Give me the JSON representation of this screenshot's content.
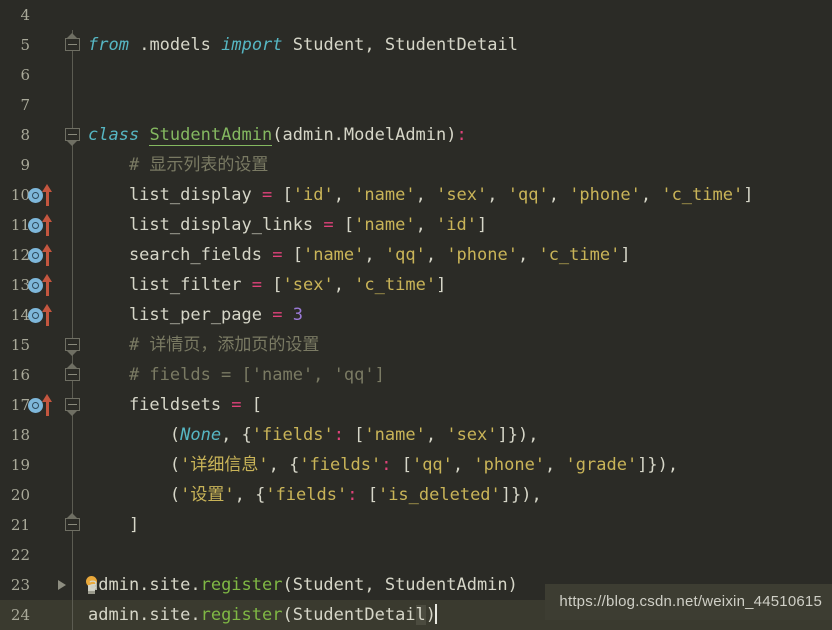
{
  "editor": {
    "theme_bg": "#2b2b26",
    "current_line_bg": "#3a3a2f",
    "gutter_number_color": "#a9a999",
    "accent_keyword": "#56b6c2",
    "accent_string": "#c9b458",
    "accent_operator": "#e0427a",
    "accent_function": "#7fb844",
    "accent_class": "#84b860",
    "accent_comment": "#7a7a63",
    "accent_number": "#9a79d6"
  },
  "lines": [
    {
      "number": "4",
      "markers": {
        "override": false,
        "uparrow": false,
        "fold": "none",
        "fold_line": false,
        "bulb": false,
        "run_triangle": false
      },
      "tokens": []
    },
    {
      "number": "5",
      "markers": {
        "override": false,
        "uparrow": false,
        "fold": "cap-up-box",
        "fold_line": true,
        "bulb": false,
        "run_triangle": false
      },
      "tokens": [
        {
          "t": "from",
          "c": "kw"
        },
        {
          "t": " ",
          "c": "def"
        },
        {
          "t": ".models",
          "c": "def"
        },
        {
          "t": " ",
          "c": "def"
        },
        {
          "t": "import",
          "c": "kw"
        },
        {
          "t": " Student, StudentDetail",
          "c": "def"
        }
      ]
    },
    {
      "number": "6",
      "markers": {
        "override": false,
        "uparrow": false,
        "fold": "none",
        "fold_line": true,
        "bulb": false,
        "run_triangle": false
      },
      "tokens": []
    },
    {
      "number": "7",
      "markers": {
        "override": false,
        "uparrow": false,
        "fold": "none",
        "fold_line": true,
        "bulb": false,
        "run_triangle": false
      },
      "tokens": []
    },
    {
      "number": "8",
      "markers": {
        "override": false,
        "uparrow": false,
        "fold": "box-cap-down",
        "fold_line": true,
        "bulb": false,
        "run_triangle": false
      },
      "tokens": [
        {
          "t": "class",
          "c": "kw"
        },
        {
          "t": " ",
          "c": "def"
        },
        {
          "t": "StudentAdmin",
          "c": "cls"
        },
        {
          "t": "(admin.ModelAdmin)",
          "c": "def"
        },
        {
          "t": ":",
          "c": "op"
        }
      ]
    },
    {
      "number": "9",
      "markers": {
        "override": false,
        "uparrow": false,
        "fold": "none",
        "fold_line": true,
        "bulb": false,
        "run_triangle": false
      },
      "tokens": [
        {
          "t": "    # 显示列表的设置",
          "c": "com"
        }
      ]
    },
    {
      "number": "10",
      "markers": {
        "override": true,
        "uparrow": true,
        "fold": "none",
        "fold_line": true,
        "bulb": false,
        "run_triangle": false
      },
      "tokens": [
        {
          "t": "    list_display ",
          "c": "def"
        },
        {
          "t": "=",
          "c": "op"
        },
        {
          "t": " [",
          "c": "punct"
        },
        {
          "t": "'id'",
          "c": "str"
        },
        {
          "t": ", ",
          "c": "punct"
        },
        {
          "t": "'name'",
          "c": "str"
        },
        {
          "t": ", ",
          "c": "punct"
        },
        {
          "t": "'sex'",
          "c": "str"
        },
        {
          "t": ", ",
          "c": "punct"
        },
        {
          "t": "'qq'",
          "c": "str"
        },
        {
          "t": ", ",
          "c": "punct"
        },
        {
          "t": "'phone'",
          "c": "str"
        },
        {
          "t": ", ",
          "c": "punct"
        },
        {
          "t": "'c_time'",
          "c": "str"
        },
        {
          "t": "]",
          "c": "punct"
        }
      ]
    },
    {
      "number": "11",
      "markers": {
        "override": true,
        "uparrow": true,
        "fold": "none",
        "fold_line": true,
        "bulb": false,
        "run_triangle": false
      },
      "tokens": [
        {
          "t": "    list_display_links ",
          "c": "def"
        },
        {
          "t": "=",
          "c": "op"
        },
        {
          "t": " [",
          "c": "punct"
        },
        {
          "t": "'name'",
          "c": "str"
        },
        {
          "t": ", ",
          "c": "punct"
        },
        {
          "t": "'id'",
          "c": "str"
        },
        {
          "t": "]",
          "c": "punct"
        }
      ]
    },
    {
      "number": "12",
      "markers": {
        "override": true,
        "uparrow": true,
        "fold": "none",
        "fold_line": true,
        "bulb": false,
        "run_triangle": false
      },
      "tokens": [
        {
          "t": "    search_fields ",
          "c": "def"
        },
        {
          "t": "=",
          "c": "op"
        },
        {
          "t": " [",
          "c": "punct"
        },
        {
          "t": "'name'",
          "c": "str"
        },
        {
          "t": ", ",
          "c": "punct"
        },
        {
          "t": "'qq'",
          "c": "str"
        },
        {
          "t": ", ",
          "c": "punct"
        },
        {
          "t": "'phone'",
          "c": "str"
        },
        {
          "t": ", ",
          "c": "punct"
        },
        {
          "t": "'c_time'",
          "c": "str"
        },
        {
          "t": "]",
          "c": "punct"
        }
      ]
    },
    {
      "number": "13",
      "markers": {
        "override": true,
        "uparrow": true,
        "fold": "none",
        "fold_line": true,
        "bulb": false,
        "run_triangle": false
      },
      "tokens": [
        {
          "t": "    list_filter ",
          "c": "def"
        },
        {
          "t": "=",
          "c": "op"
        },
        {
          "t": " [",
          "c": "punct"
        },
        {
          "t": "'sex'",
          "c": "str"
        },
        {
          "t": ", ",
          "c": "punct"
        },
        {
          "t": "'c_time'",
          "c": "str"
        },
        {
          "t": "]",
          "c": "punct"
        }
      ]
    },
    {
      "number": "14",
      "markers": {
        "override": true,
        "uparrow": true,
        "fold": "none",
        "fold_line": true,
        "bulb": false,
        "run_triangle": false
      },
      "tokens": [
        {
          "t": "    list_per_page ",
          "c": "def"
        },
        {
          "t": "=",
          "c": "op"
        },
        {
          "t": " ",
          "c": "punct"
        },
        {
          "t": "3",
          "c": "num"
        }
      ]
    },
    {
      "number": "15",
      "markers": {
        "override": false,
        "uparrow": false,
        "fold": "box-cap-down",
        "fold_line": true,
        "bulb": false,
        "run_triangle": false
      },
      "tokens": [
        {
          "t": "    # 详情页，添加页的设置",
          "c": "com"
        }
      ]
    },
    {
      "number": "16",
      "markers": {
        "override": false,
        "uparrow": false,
        "fold": "cap-up-box",
        "fold_line": true,
        "bulb": false,
        "run_triangle": false
      },
      "tokens": [
        {
          "t": "    # fields = ['name', 'qq']",
          "c": "com"
        }
      ]
    },
    {
      "number": "17",
      "markers": {
        "override": true,
        "uparrow": true,
        "fold": "box-cap-down",
        "fold_line": true,
        "bulb": false,
        "run_triangle": false
      },
      "tokens": [
        {
          "t": "    fieldsets ",
          "c": "def"
        },
        {
          "t": "=",
          "c": "op"
        },
        {
          "t": " [",
          "c": "punct"
        }
      ]
    },
    {
      "number": "18",
      "markers": {
        "override": false,
        "uparrow": false,
        "fold": "none",
        "fold_line": true,
        "bulb": false,
        "run_triangle": false
      },
      "tokens": [
        {
          "t": "        (",
          "c": "punct"
        },
        {
          "t": "None",
          "c": "none"
        },
        {
          "t": ", {",
          "c": "punct"
        },
        {
          "t": "'fields'",
          "c": "str"
        },
        {
          "t": ":",
          "c": "op"
        },
        {
          "t": " [",
          "c": "punct"
        },
        {
          "t": "'name'",
          "c": "str"
        },
        {
          "t": ", ",
          "c": "punct"
        },
        {
          "t": "'sex'",
          "c": "str"
        },
        {
          "t": "]}),",
          "c": "punct"
        }
      ]
    },
    {
      "number": "19",
      "markers": {
        "override": false,
        "uparrow": false,
        "fold": "none",
        "fold_line": true,
        "bulb": false,
        "run_triangle": false
      },
      "tokens": [
        {
          "t": "        (",
          "c": "punct"
        },
        {
          "t": "'详细信息'",
          "c": "str"
        },
        {
          "t": ", {",
          "c": "punct"
        },
        {
          "t": "'fields'",
          "c": "str"
        },
        {
          "t": ":",
          "c": "op"
        },
        {
          "t": " [",
          "c": "punct"
        },
        {
          "t": "'qq'",
          "c": "str"
        },
        {
          "t": ", ",
          "c": "punct"
        },
        {
          "t": "'phone'",
          "c": "str"
        },
        {
          "t": ", ",
          "c": "punct"
        },
        {
          "t": "'grade'",
          "c": "str"
        },
        {
          "t": "]}),",
          "c": "punct"
        }
      ]
    },
    {
      "number": "20",
      "markers": {
        "override": false,
        "uparrow": false,
        "fold": "none",
        "fold_line": true,
        "bulb": false,
        "run_triangle": false
      },
      "tokens": [
        {
          "t": "        (",
          "c": "punct"
        },
        {
          "t": "'设置'",
          "c": "str"
        },
        {
          "t": ", {",
          "c": "punct"
        },
        {
          "t": "'fields'",
          "c": "str"
        },
        {
          "t": ":",
          "c": "op"
        },
        {
          "t": " [",
          "c": "punct"
        },
        {
          "t": "'is_deleted'",
          "c": "str"
        },
        {
          "t": "]}),",
          "c": "punct"
        }
      ]
    },
    {
      "number": "21",
      "markers": {
        "override": false,
        "uparrow": false,
        "fold": "cap-up-box",
        "fold_line": true,
        "bulb": false,
        "run_triangle": false
      },
      "tokens": [
        {
          "t": "    ]",
          "c": "punct"
        }
      ]
    },
    {
      "number": "22",
      "markers": {
        "override": false,
        "uparrow": false,
        "fold": "none",
        "fold_line": true,
        "bulb": false,
        "run_triangle": false
      },
      "tokens": []
    },
    {
      "number": "23",
      "markers": {
        "override": false,
        "uparrow": false,
        "fold": "none",
        "fold_line": true,
        "bulb": true,
        "run_triangle": true
      },
      "tokens": [
        {
          "t": "admin.site.",
          "c": "def"
        },
        {
          "t": "register",
          "c": "fn"
        },
        {
          "t": "(Student, StudentAdmin)",
          "c": "def"
        }
      ]
    },
    {
      "number": "24",
      "markers": {
        "override": false,
        "uparrow": false,
        "fold": "none",
        "fold_line": true,
        "bulb": false,
        "run_triangle": false
      },
      "current": true,
      "caret": true,
      "tokens": [
        {
          "t": "admin.site.",
          "c": "def"
        },
        {
          "t": "register",
          "c": "fn"
        },
        {
          "t": "(StudentDetai",
          "c": "def"
        },
        {
          "t": "l",
          "c": "def sel"
        },
        {
          "t": ")",
          "c": "def"
        }
      ]
    }
  ],
  "watermark": {
    "text": "https://blog.csdn.net/weixin_44510615"
  }
}
